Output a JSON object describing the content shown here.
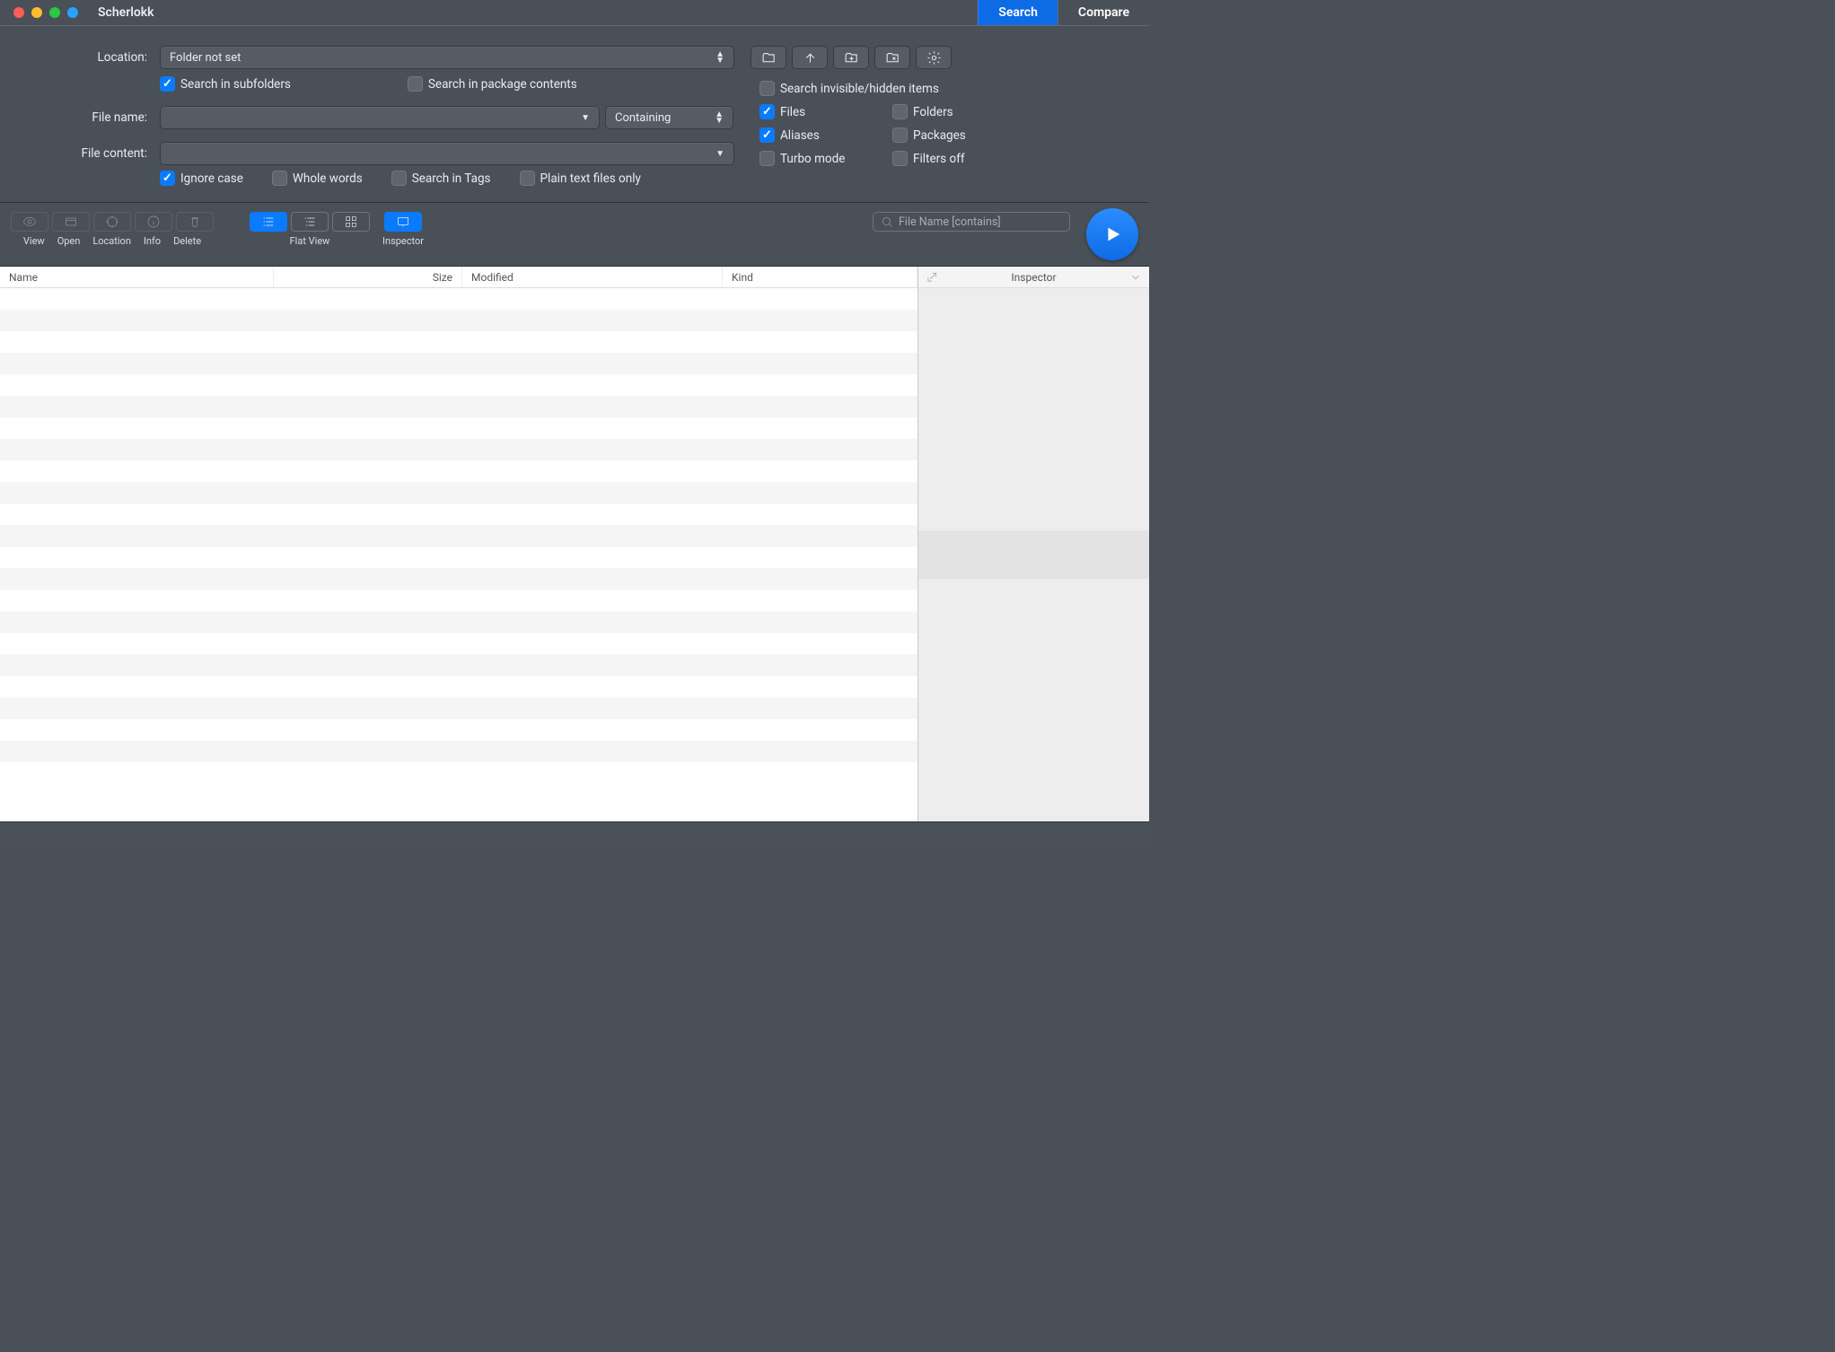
{
  "app_title": "Scherlokk",
  "tabs": {
    "search": "Search",
    "compare": "Compare"
  },
  "labels": {
    "location": "Location:",
    "file_name": "File name:",
    "file_content": "File content:"
  },
  "location": {
    "value": "Folder not set"
  },
  "filename": {
    "match_mode": "Containing"
  },
  "checks": {
    "subfolders": "Search in subfolders",
    "packages": "Search in package contents",
    "invisible": "Search invisible/hidden items",
    "files": "Files",
    "folders": "Folders",
    "aliases": "Aliases",
    "packages_type": "Packages",
    "turbo": "Turbo mode",
    "filters_off": "Filters off",
    "ignore_case": "Ignore case",
    "whole_words": "Whole words",
    "search_tags": "Search in Tags",
    "plain_text": "Plain text files only"
  },
  "toolbar": {
    "view": "View",
    "open": "Open",
    "location": "Location",
    "info": "Info",
    "delete": "Delete",
    "flat_view": "Flat View",
    "inspector": "Inspector"
  },
  "filter": {
    "placeholder": "File Name [contains]"
  },
  "columns": {
    "name": "Name",
    "size": "Size",
    "modified": "Modified",
    "kind": "Kind"
  },
  "inspector": {
    "title": "Inspector"
  }
}
